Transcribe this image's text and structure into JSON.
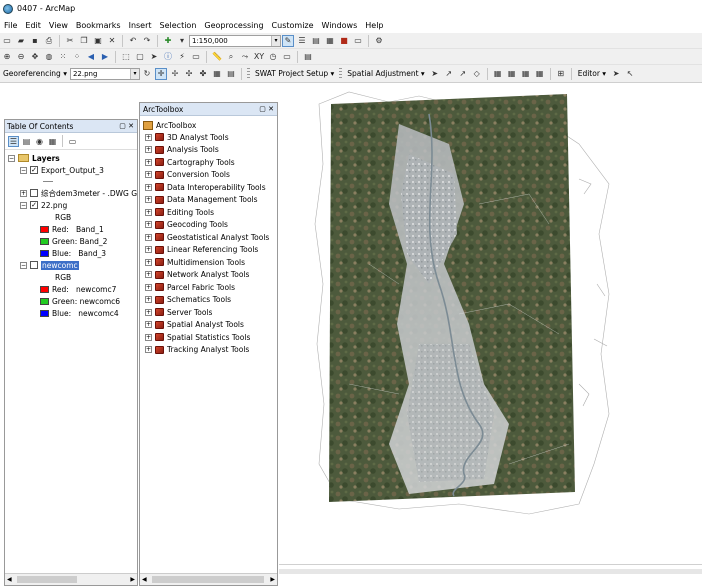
{
  "window": {
    "title": "0407 - ArcMap"
  },
  "menu": [
    "File",
    "Edit",
    "View",
    "Bookmarks",
    "Insert",
    "Selection",
    "Geoprocessing",
    "Customize",
    "Windows",
    "Help"
  ],
  "toolbar": {
    "scale_value": "1:150,000",
    "georeferencing_label": "Georeferencing",
    "layer_combo_value": "22.png",
    "swat_label": "SWAT Project Setup",
    "spatial_adjustment_label": "Spatial Adjustment",
    "editor_label": "Editor"
  },
  "toc": {
    "title": "Table Of Contents",
    "root": "Layers",
    "layers": [
      {
        "name": "Export_Output_3",
        "checked": true,
        "expanded": true
      },
      {
        "name": "综合dem3meter - .DWG G",
        "checked": false,
        "expanded": false
      },
      {
        "name": "22.png",
        "checked": true,
        "expanded": true,
        "legend_title": "RGB",
        "bands": [
          {
            "label": "Red:",
            "value": "Band_1",
            "color": "#ff0000"
          },
          {
            "label": "Green:",
            "value": "Band_2",
            "color": "#22cc22"
          },
          {
            "label": "Blue:",
            "value": "Band_3",
            "color": "#0000ff"
          }
        ]
      },
      {
        "name": "newcomc",
        "checked": false,
        "expanded": true,
        "selected": true,
        "legend_title": "RGB",
        "bands": [
          {
            "label": "Red:",
            "value": "newcomc7",
            "color": "#ff0000"
          },
          {
            "label": "Green:",
            "value": "newcomc6",
            "color": "#22cc22"
          },
          {
            "label": "Blue:",
            "value": "newcomc4",
            "color": "#0000ff"
          }
        ]
      }
    ]
  },
  "toolbox": {
    "title": "ArcToolbox",
    "root": "ArcToolbox",
    "items": [
      "3D Analyst Tools",
      "Analysis Tools",
      "Cartography Tools",
      "Conversion Tools",
      "Data Interoperability Tools",
      "Data Management Tools",
      "Editing Tools",
      "Geocoding Tools",
      "Geostatistical Analyst Tools",
      "Linear Referencing Tools",
      "Multidimension Tools",
      "Network Analyst Tools",
      "Parcel Fabric Tools",
      "Schematics Tools",
      "Server Tools",
      "Spatial Analyst Tools",
      "Spatial Statistics Tools",
      "Tracking Analyst Tools"
    ]
  },
  "colors": {
    "panel_header": "#dbe6f4",
    "selection": "#3d6fc7",
    "toolbar_bg": "#f0f0f0"
  }
}
